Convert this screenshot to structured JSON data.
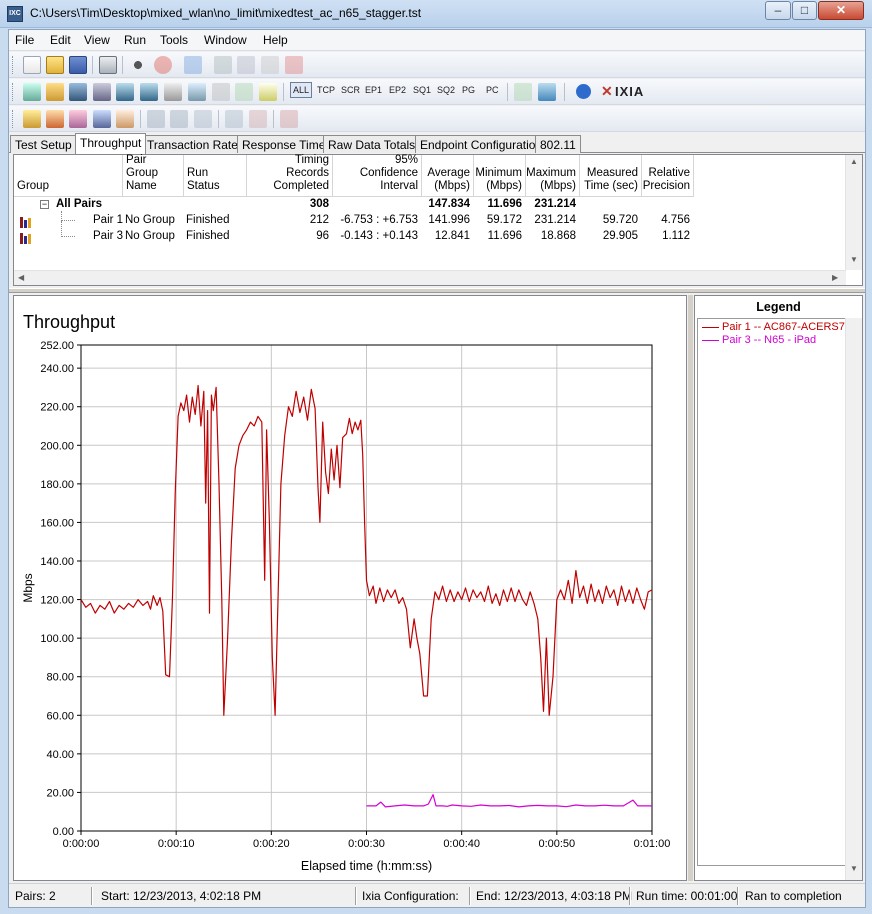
{
  "window": {
    "title": "C:\\Users\\Tim\\Desktop\\mixed_wlan\\no_limit\\mixedtest_ac_n65_stagger.tst",
    "app_icon_text": "IXC",
    "minimize": "–",
    "restore": "□",
    "close": "✕"
  },
  "menu": [
    "File",
    "Edit",
    "View",
    "Run",
    "Tools",
    "Window",
    "Help"
  ],
  "toolbar2": {
    "filters": [
      "ALL",
      "TCP",
      "SCR",
      "EP1",
      "EP2",
      "SQ1",
      "SQ2",
      "PG",
      "PC"
    ],
    "brand": "IXIA"
  },
  "tabs": [
    "Test Setup",
    "Throughput",
    "Transaction Rate",
    "Response Time",
    "Raw Data Totals",
    "Endpoint Configuration",
    "802.11"
  ],
  "grid": {
    "columns": [
      "Group",
      "Pair Group Name",
      "Run Status",
      "Timing Records Completed",
      "95% Confidence Interval",
      "Average (Mbps)",
      "Minimum (Mbps)",
      "Maximum (Mbps)",
      "Measured Time (sec)",
      "Relative Precision"
    ],
    "all_pairs": {
      "label": "All Pairs",
      "expander": "−",
      "records": "308",
      "average": "147.834",
      "minimum": "11.696",
      "maximum": "231.214"
    },
    "rows": [
      {
        "pair": "Pair 1",
        "group": "No Group",
        "status": "Finished",
        "records": "212",
        "ci": "-6.753 : +6.753",
        "average": "141.996",
        "minimum": "59.172",
        "maximum": "231.214",
        "time": "59.720",
        "precision": "4.756"
      },
      {
        "pair": "Pair 3",
        "group": "No Group",
        "status": "Finished",
        "records": "96",
        "ci": "-0.143 : +0.143",
        "average": "12.841",
        "minimum": "11.696",
        "maximum": "18.868",
        "time": "29.905",
        "precision": "1.112"
      }
    ]
  },
  "legend": {
    "title": "Legend",
    "items": [
      {
        "label": "Pair 1 -- AC867-ACERS7",
        "color": "#c00000"
      },
      {
        "label": "Pair 3 -- N65 - iPad",
        "color": "#d400d4"
      }
    ]
  },
  "chart_data": {
    "type": "line",
    "title": "Throughput",
    "xlabel": "Elapsed time (h:mm:ss)",
    "ylabel": "Mbps",
    "xlim": [
      0,
      60
    ],
    "ylim": [
      0,
      252
    ],
    "x_ticks": [
      0,
      10,
      20,
      30,
      40,
      50,
      60
    ],
    "x_tick_labels": [
      "0:00:00",
      "0:00:10",
      "0:00:20",
      "0:00:30",
      "0:00:40",
      "0:00:50",
      "0:01:00"
    ],
    "y_ticks": [
      0,
      20,
      40,
      60,
      80,
      100,
      120,
      140,
      160,
      180,
      200,
      220,
      240,
      252
    ],
    "y_tick_labels": [
      "0.00",
      "20.00",
      "40.00",
      "60.00",
      "80.00",
      "100.00",
      "120.00",
      "140.00",
      "160.00",
      "180.00",
      "200.00",
      "220.00",
      "240.00",
      "252.00"
    ],
    "grid": true,
    "series": [
      {
        "name": "Pair 1 -- AC867-ACERS7",
        "color": "#c00000",
        "points": [
          [
            0,
            120
          ],
          [
            0.5,
            116
          ],
          [
            1,
            118
          ],
          [
            1.5,
            113
          ],
          [
            2,
            117
          ],
          [
            2.5,
            115
          ],
          [
            3,
            119
          ],
          [
            3.5,
            113
          ],
          [
            4,
            117
          ],
          [
            4.5,
            115
          ],
          [
            5,
            118
          ],
          [
            5.5,
            116
          ],
          [
            6,
            120
          ],
          [
            6.5,
            117
          ],
          [
            7,
            119
          ],
          [
            7.3,
            115
          ],
          [
            7.6,
            122
          ],
          [
            8,
            117
          ],
          [
            8.3,
            121
          ],
          [
            8.6,
            114
          ],
          [
            8.9,
            81
          ],
          [
            9.3,
            80
          ],
          [
            9.6,
            120
          ],
          [
            9.9,
            175
          ],
          [
            10.2,
            215
          ],
          [
            10.5,
            222
          ],
          [
            10.8,
            218
          ],
          [
            11.1,
            226
          ],
          [
            11.4,
            212
          ],
          [
            11.7,
            225
          ],
          [
            12,
            216
          ],
          [
            12.3,
            231
          ],
          [
            12.6,
            210
          ],
          [
            12.9,
            228
          ],
          [
            13.1,
            170
          ],
          [
            13.3,
            218
          ],
          [
            13.5,
            113
          ],
          [
            13.7,
            226
          ],
          [
            13.9,
            218
          ],
          [
            14.2,
            230
          ],
          [
            14.5,
            180
          ],
          [
            14.8,
            120
          ],
          [
            15,
            60
          ],
          [
            15.4,
            100
          ],
          [
            15.8,
            150
          ],
          [
            16.2,
            188
          ],
          [
            16.6,
            200
          ],
          [
            17,
            205
          ],
          [
            17.4,
            208
          ],
          [
            17.8,
            212
          ],
          [
            18.2,
            210
          ],
          [
            18.6,
            215
          ],
          [
            19,
            212
          ],
          [
            19.3,
            130
          ],
          [
            19.5,
            208
          ],
          [
            19.8,
            160
          ],
          [
            20.1,
            90
          ],
          [
            20.4,
            60
          ],
          [
            20.7,
            120
          ],
          [
            21,
            180
          ],
          [
            21.4,
            205
          ],
          [
            21.8,
            220
          ],
          [
            22.2,
            215
          ],
          [
            22.6,
            228
          ],
          [
            23,
            217
          ],
          [
            23.4,
            225
          ],
          [
            23.8,
            213
          ],
          [
            24.2,
            229
          ],
          [
            24.6,
            219
          ],
          [
            24.9,
            178
          ],
          [
            25.1,
            160
          ],
          [
            25.4,
            212
          ],
          [
            25.7,
            186
          ],
          [
            26,
            175
          ],
          [
            26.3,
            198
          ],
          [
            26.6,
            182
          ],
          [
            26.9,
            200
          ],
          [
            27.2,
            178
          ],
          [
            27.5,
            204
          ],
          [
            27.9,
            206
          ],
          [
            28.2,
            214
          ],
          [
            28.5,
            206
          ],
          [
            28.8,
            212
          ],
          [
            29.1,
            208
          ],
          [
            29.4,
            213
          ],
          [
            29.6,
            195
          ],
          [
            29.8,
            160
          ],
          [
            30,
            130
          ],
          [
            30.3,
            122
          ],
          [
            30.7,
            127
          ],
          [
            31,
            118
          ],
          [
            31.4,
            126
          ],
          [
            31.8,
            119
          ],
          [
            32.2,
            125
          ],
          [
            32.6,
            121
          ],
          [
            33,
            125
          ],
          [
            33.4,
            118
          ],
          [
            33.8,
            121
          ],
          [
            34.2,
            115
          ],
          [
            34.6,
            95
          ],
          [
            35,
            110
          ],
          [
            35.3,
            100
          ],
          [
            35.6,
            92
          ],
          [
            36,
            70
          ],
          [
            36.4,
            70
          ],
          [
            36.8,
            110
          ],
          [
            37.2,
            124
          ],
          [
            37.6,
            120
          ],
          [
            38,
            127
          ],
          [
            38.4,
            119
          ],
          [
            38.8,
            125
          ],
          [
            39.2,
            119
          ],
          [
            39.6,
            124
          ],
          [
            40,
            120
          ],
          [
            40.4,
            126
          ],
          [
            40.8,
            119
          ],
          [
            41.2,
            125
          ],
          [
            41.6,
            121
          ],
          [
            42,
            124
          ],
          [
            42.4,
            119
          ],
          [
            42.8,
            127
          ],
          [
            43.2,
            118
          ],
          [
            43.6,
            123
          ],
          [
            44,
            117
          ],
          [
            44.4,
            125
          ],
          [
            44.8,
            119
          ],
          [
            45.2,
            126
          ],
          [
            45.6,
            119
          ],
          [
            46,
            125
          ],
          [
            46.4,
            120
          ],
          [
            46.8,
            117
          ],
          [
            47.2,
            124
          ],
          [
            47.6,
            118
          ],
          [
            48,
            110
          ],
          [
            48.3,
            90
          ],
          [
            48.6,
            62
          ],
          [
            48.9,
            100
          ],
          [
            49.2,
            60
          ],
          [
            49.6,
            80
          ],
          [
            50,
            120
          ],
          [
            50.4,
            125
          ],
          [
            50.8,
            120
          ],
          [
            51.2,
            130
          ],
          [
            51.6,
            118
          ],
          [
            52,
            135
          ],
          [
            52.4,
            121
          ],
          [
            52.8,
            127
          ],
          [
            53.2,
            118
          ],
          [
            53.6,
            128
          ],
          [
            54,
            119
          ],
          [
            54.4,
            125
          ],
          [
            54.8,
            118
          ],
          [
            55.2,
            127
          ],
          [
            55.6,
            121
          ],
          [
            56,
            125
          ],
          [
            56.4,
            117
          ],
          [
            56.8,
            127
          ],
          [
            57.2,
            119
          ],
          [
            57.6,
            125
          ],
          [
            58,
            118
          ],
          [
            58.4,
            126
          ],
          [
            58.8,
            120
          ],
          [
            59.2,
            115
          ],
          [
            59.6,
            124
          ],
          [
            60,
            125
          ]
        ]
      },
      {
        "name": "Pair 3 -- N65 - iPad",
        "color": "#d400d4",
        "points": [
          [
            30,
            13
          ],
          [
            31,
            13
          ],
          [
            31.5,
            15
          ],
          [
            32,
            12.5
          ],
          [
            33,
            13
          ],
          [
            34,
            13.5
          ],
          [
            35,
            13
          ],
          [
            36,
            13
          ],
          [
            36.5,
            14
          ],
          [
            37,
            18.9
          ],
          [
            37.3,
            13
          ],
          [
            38,
            13
          ],
          [
            38.5,
            12.8
          ],
          [
            39,
            13.5
          ],
          [
            40,
            13
          ],
          [
            41,
            12.8
          ],
          [
            42,
            13.5
          ],
          [
            43,
            13
          ],
          [
            44,
            13
          ],
          [
            45,
            13.2
          ],
          [
            46,
            12.5
          ],
          [
            47,
            13
          ],
          [
            48,
            13.3
          ],
          [
            49,
            13
          ],
          [
            50,
            13
          ],
          [
            51,
            12.6
          ],
          [
            52,
            13.5
          ],
          [
            53,
            13
          ],
          [
            54,
            13
          ],
          [
            55,
            13.4
          ],
          [
            56,
            13
          ],
          [
            57,
            13
          ],
          [
            58,
            16
          ],
          [
            58.5,
            13
          ],
          [
            59,
            13
          ],
          [
            60,
            13
          ]
        ]
      }
    ]
  },
  "status": {
    "pairs": "Pairs: 2",
    "start": "Start: 12/23/2013, 4:02:18 PM",
    "ixia_config": "Ixia Configuration:",
    "end": "End: 12/23/2013, 4:03:18 PM",
    "run_time": "Run time: 00:01:00",
    "result": "Ran to completion"
  }
}
